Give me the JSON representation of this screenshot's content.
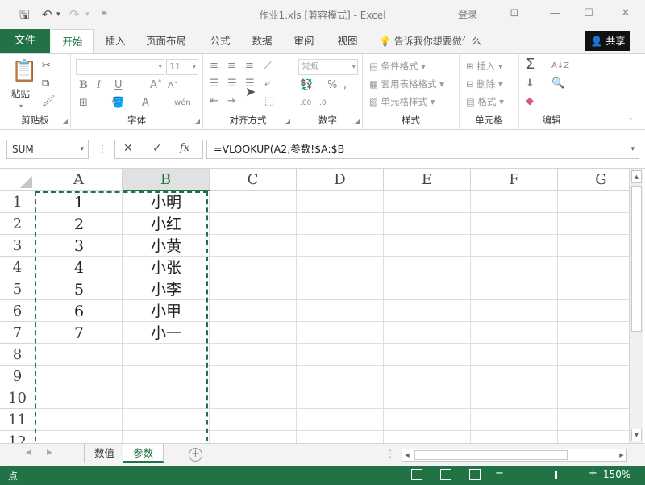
{
  "title": "作业1.xls  [兼容模式] - Excel",
  "login": "登录",
  "colors": {
    "accent": "#217346",
    "marquee": "#217346"
  },
  "tabs": {
    "file": "文件",
    "items": [
      "开始",
      "插入",
      "页面布局",
      "公式",
      "数据",
      "审阅",
      "视图"
    ],
    "active": "开始",
    "tellme": "告诉我你想要做什么",
    "share": "共享"
  },
  "ribbon": {
    "groups": [
      "剪贴板",
      "字体",
      "对齐方式",
      "数字",
      "样式",
      "单元格",
      "编辑"
    ],
    "paste": "粘贴",
    "number_format": "常规",
    "font_size": "11",
    "styles": [
      "条件格式",
      "套用表格格式",
      "单元格样式"
    ],
    "cells": [
      "插入",
      "删除",
      "格式"
    ],
    "font_buttons": [
      "B",
      "I",
      "U"
    ]
  },
  "formula_bar": {
    "name_box": "SUM",
    "formula": "=VLOOKUP(A2,参数!$A:$B",
    "fx": "fx"
  },
  "grid": {
    "columns": [
      "A",
      "B",
      "C",
      "D",
      "E",
      "F",
      "G"
    ],
    "selected_column": "B",
    "rows": [
      "1",
      "2",
      "3",
      "4",
      "5",
      "6",
      "7",
      "8",
      "9",
      "10",
      "11",
      "12"
    ],
    "cells": [
      [
        "1",
        "小明"
      ],
      [
        "2",
        "小红"
      ],
      [
        "3",
        "小黄"
      ],
      [
        "4",
        "小张"
      ],
      [
        "5",
        "小李"
      ],
      [
        "6",
        "小甲"
      ],
      [
        "7",
        "小一"
      ]
    ]
  },
  "sheets": [
    "数值",
    "参数"
  ],
  "active_sheet": "参数",
  "status": {
    "mode": "点",
    "zoom": "150%",
    "zoom_fraction": 0.6
  }
}
